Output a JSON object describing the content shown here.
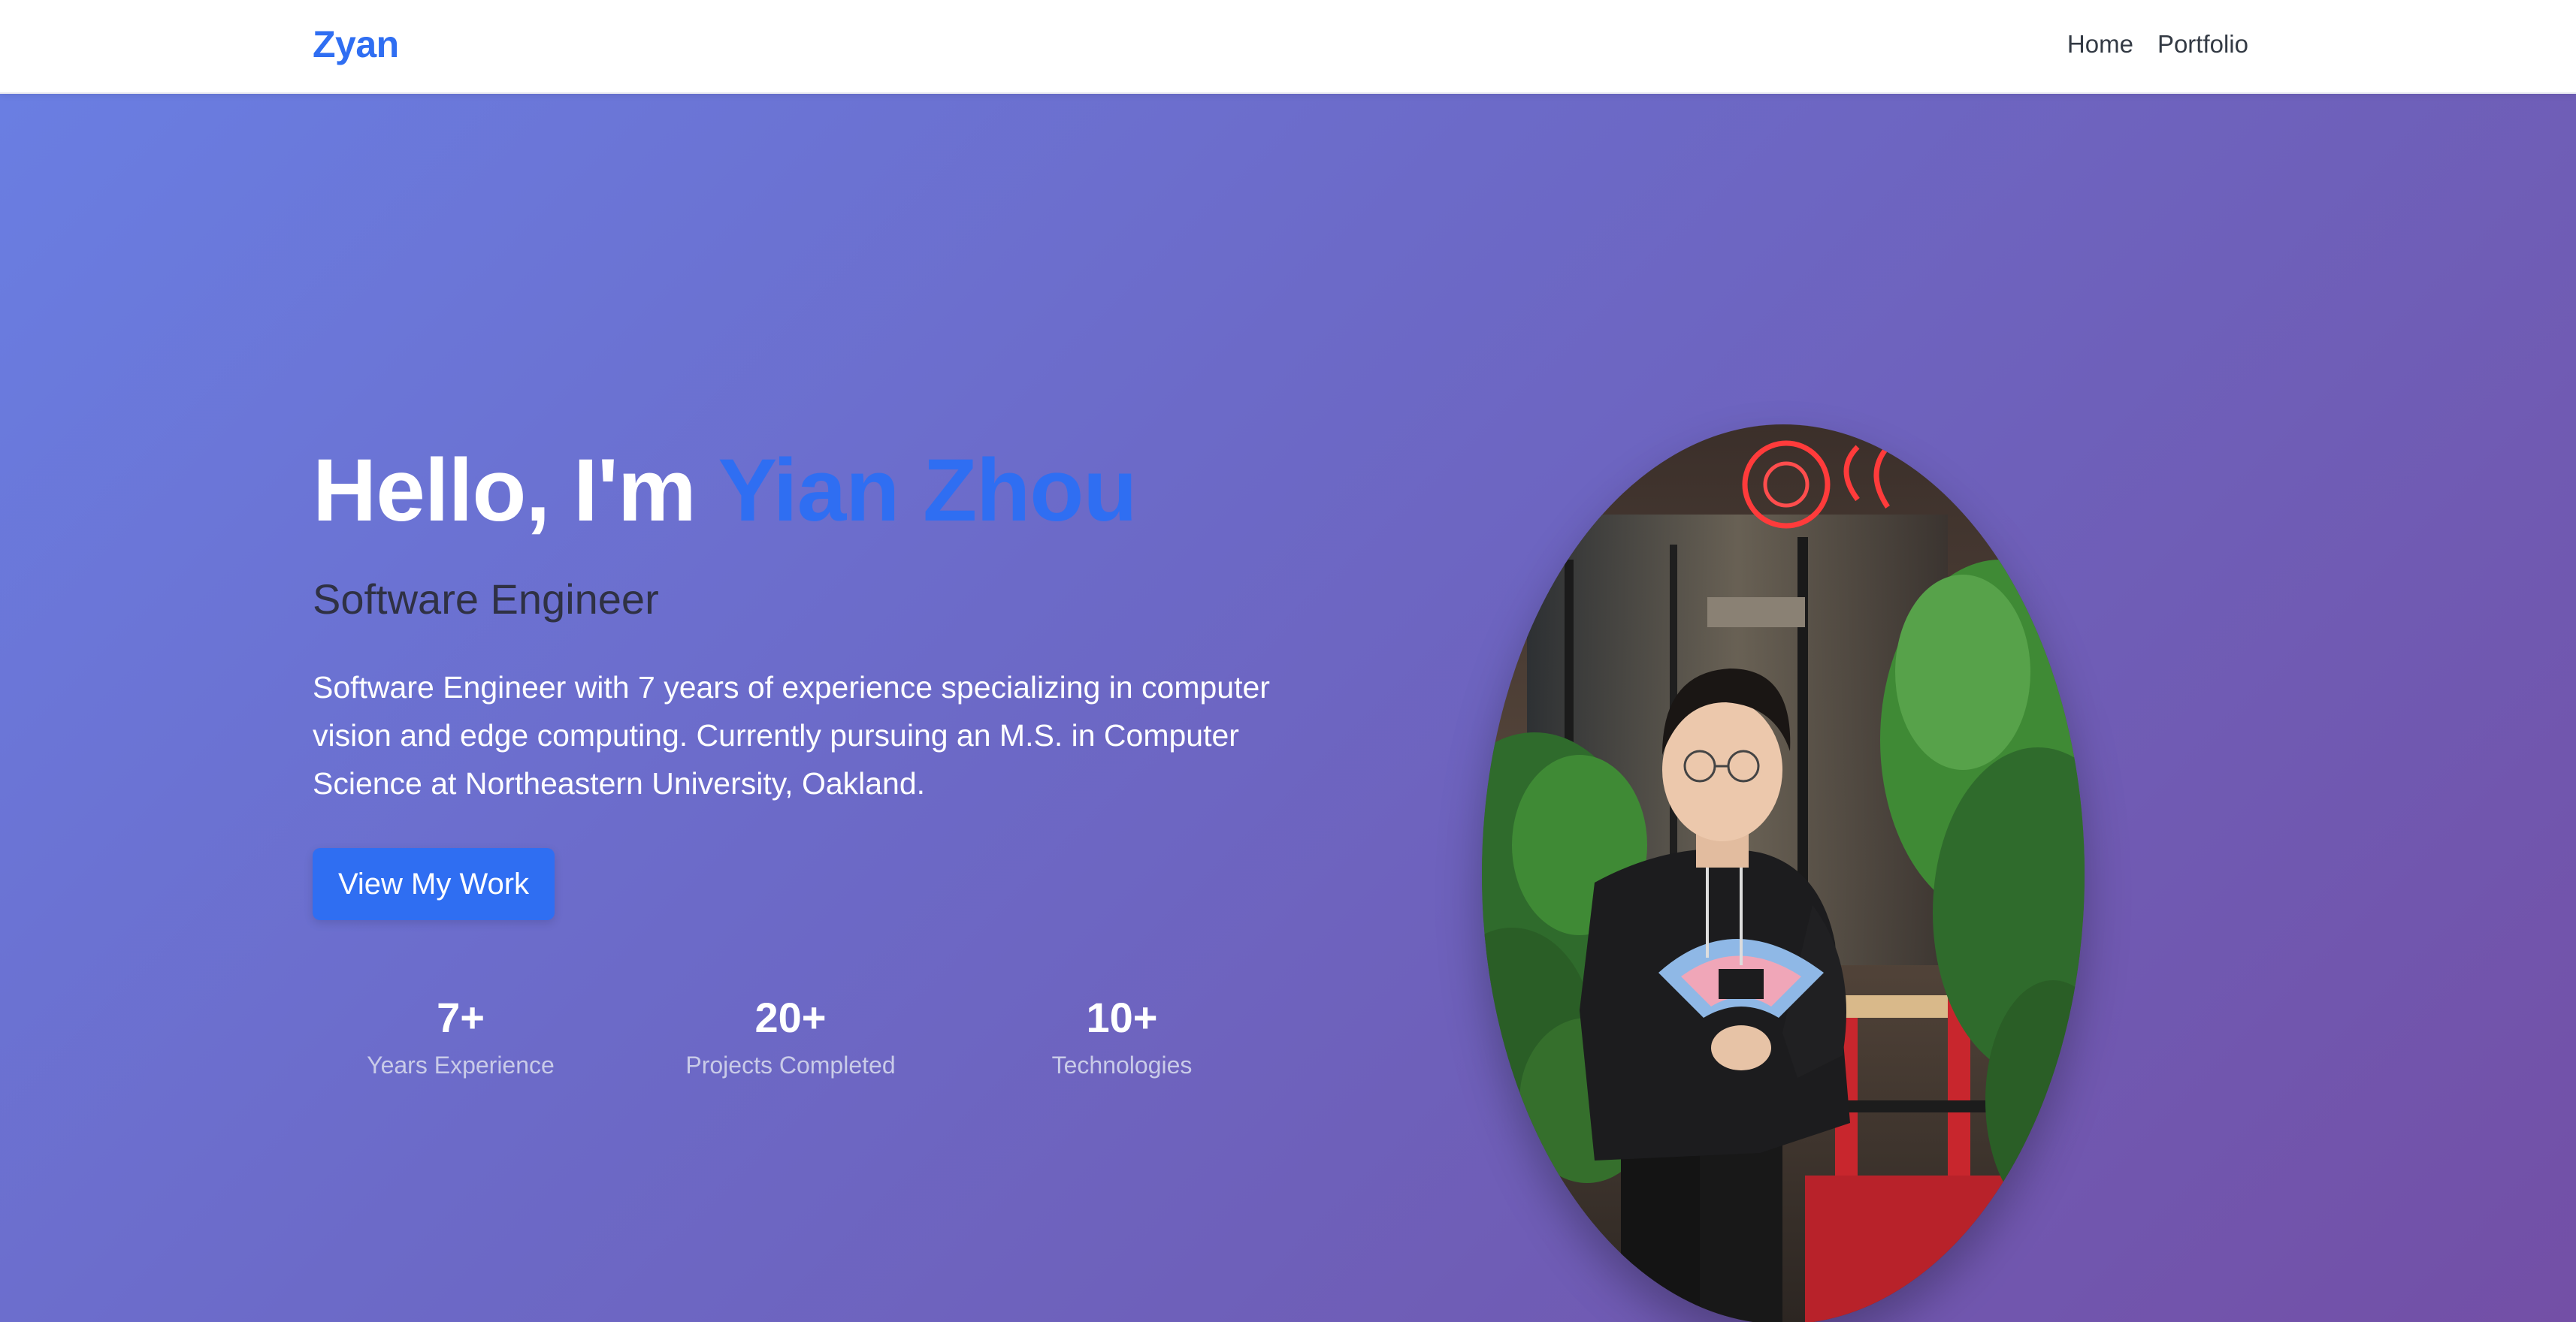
{
  "nav": {
    "brand": "Zyan",
    "links": [
      {
        "label": "Home"
      },
      {
        "label": "Portfolio"
      }
    ]
  },
  "hero": {
    "greeting": "Hello, I'm ",
    "name": "Yian Zhou",
    "subtitle": "Software Engineer",
    "description": "Software Engineer with 7 years of experience specializing in computer vision and edge computing. Currently pursuing an M.S. in Computer Science at Northeastern University, Oakland.",
    "cta_label": "View My Work",
    "stats": [
      {
        "value": "7+",
        "label": "Years Experience"
      },
      {
        "value": "20+",
        "label": "Projects Completed"
      },
      {
        "value": "10+",
        "label": "Technologies"
      }
    ]
  },
  "colors": {
    "accent": "#2f6ef2",
    "gradient_start": "#6a7ee2",
    "gradient_end": "#734fa6"
  }
}
